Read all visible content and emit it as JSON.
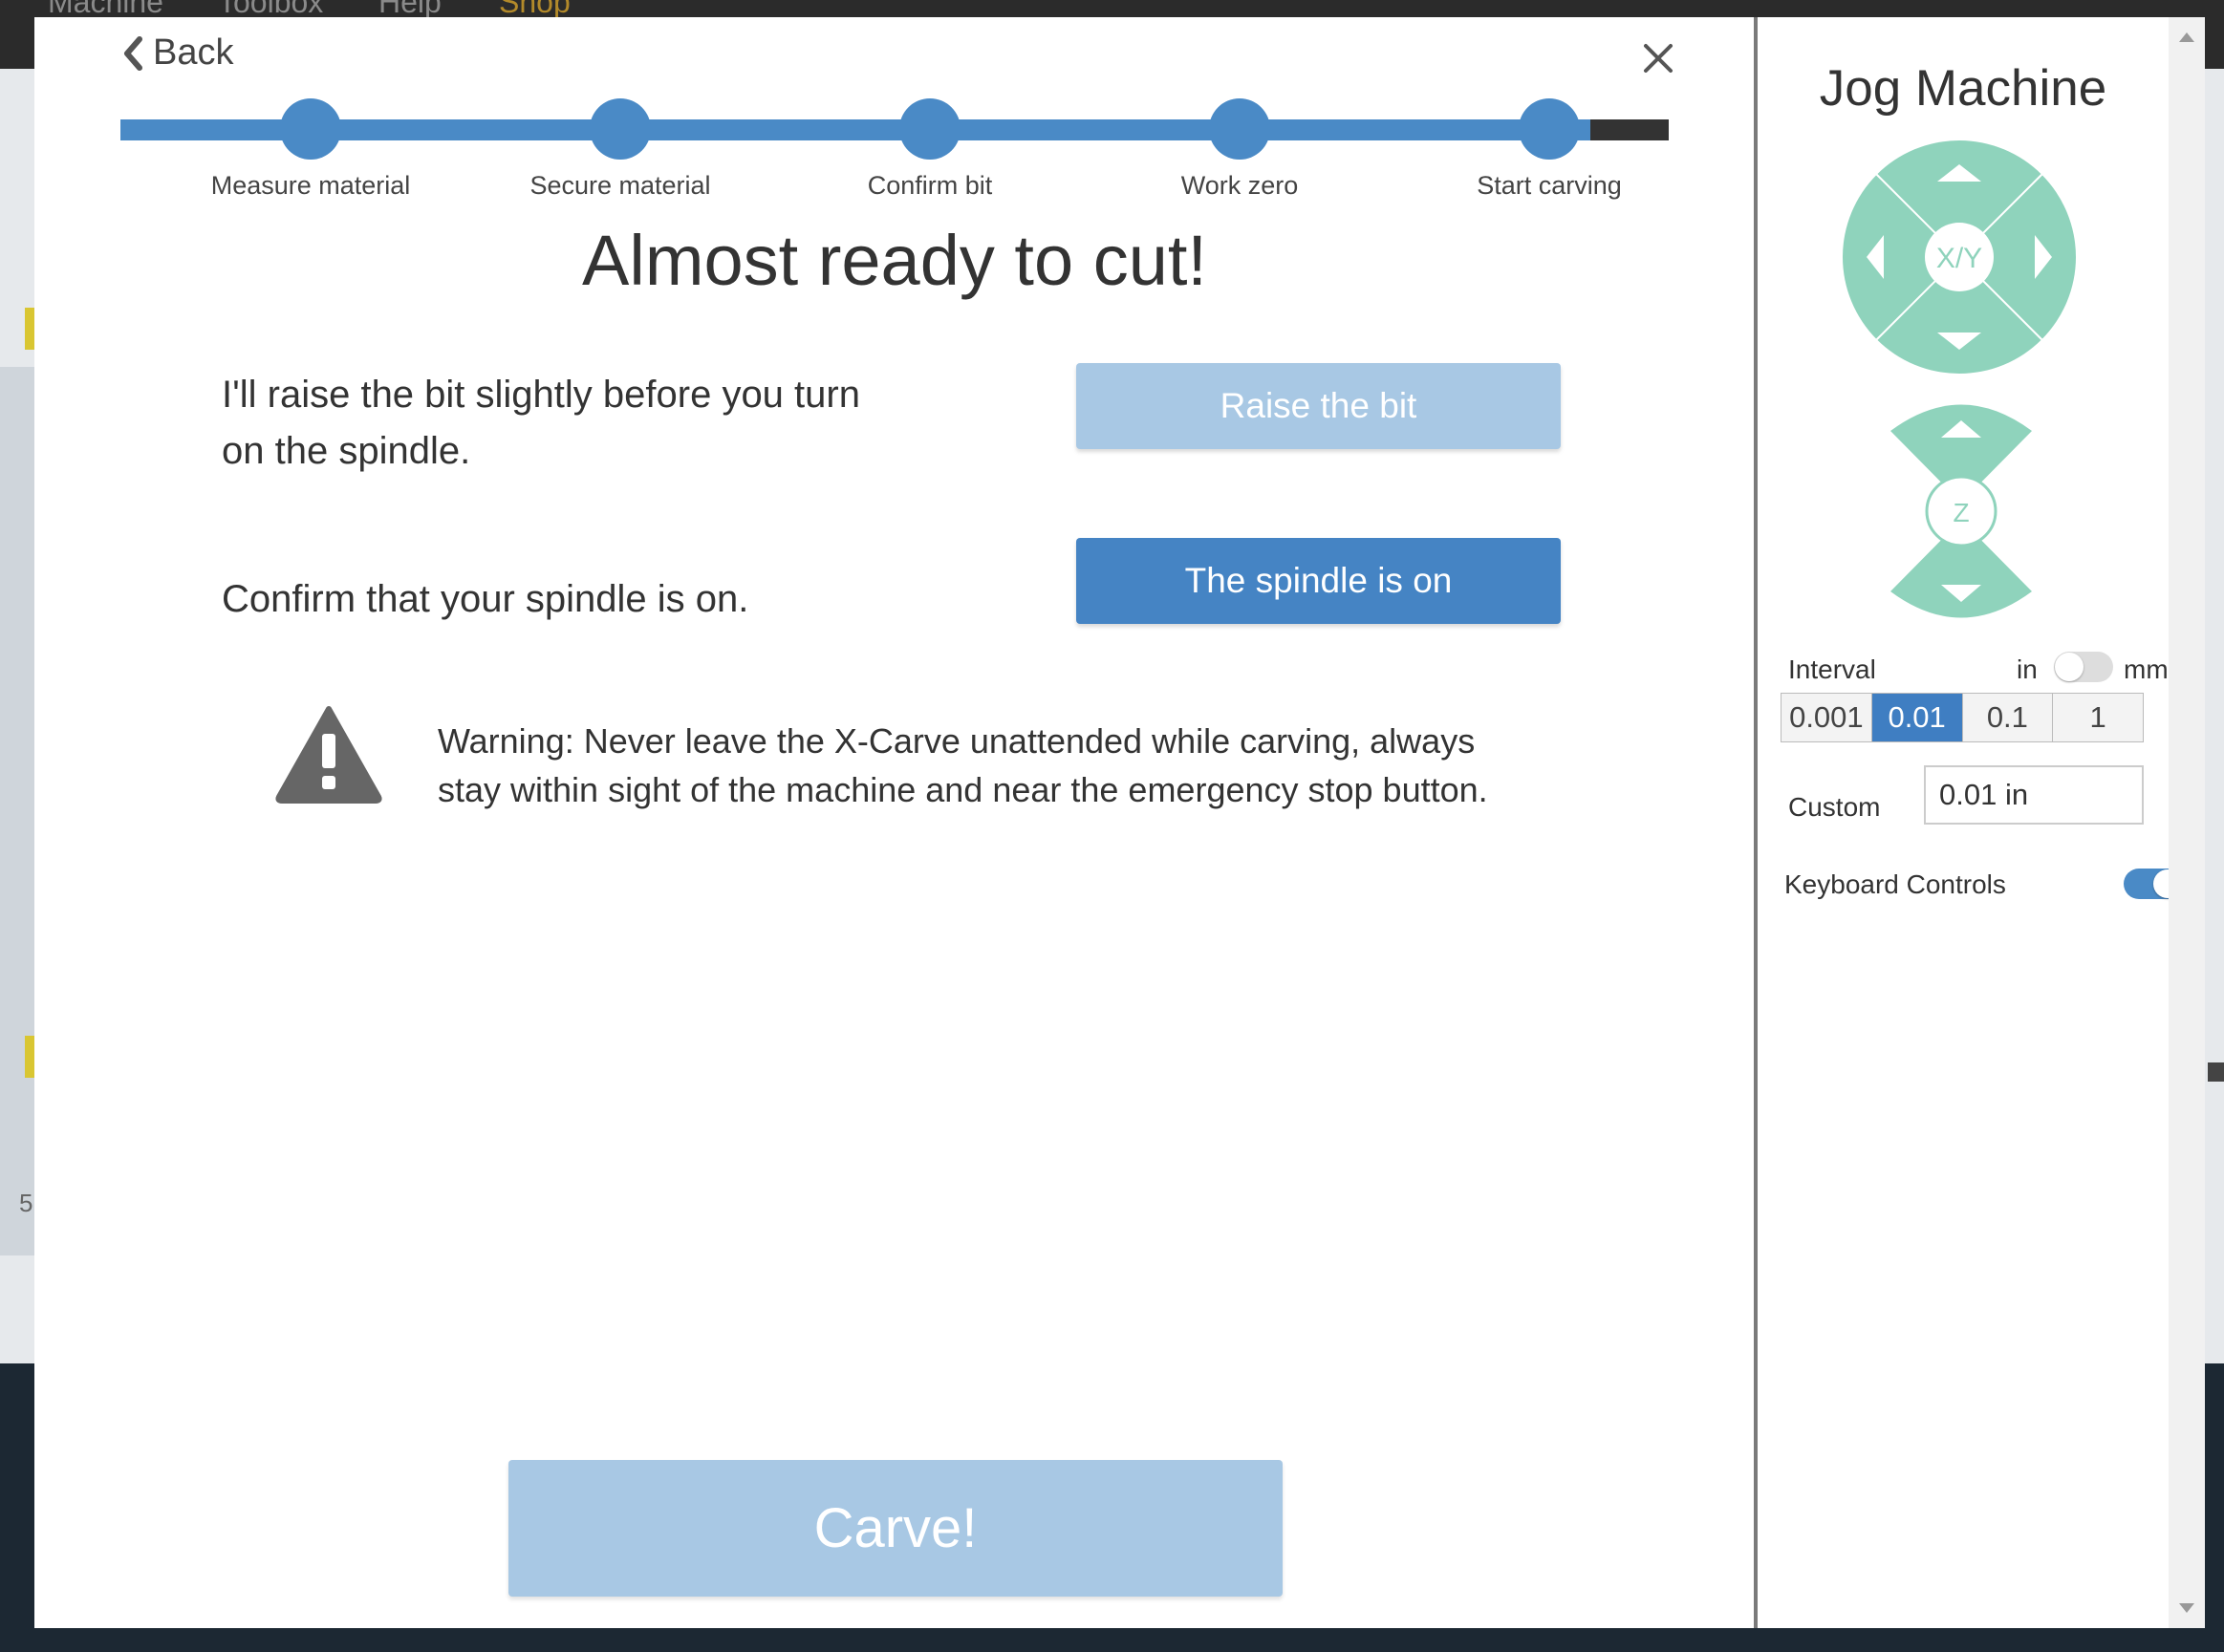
{
  "background_app": {
    "menu": [
      "Machine",
      "Toolbox",
      "Help",
      "Shop"
    ],
    "side_number": "5"
  },
  "modal": {
    "back_label": "Back",
    "steps": [
      {
        "label": "Measure material",
        "status": "complete"
      },
      {
        "label": "Secure material",
        "status": "complete"
      },
      {
        "label": "Confirm bit",
        "status": "complete"
      },
      {
        "label": "Work zero",
        "status": "complete"
      },
      {
        "label": "Start carving",
        "status": "current"
      }
    ],
    "heading": "Almost ready to cut!",
    "raise_row": {
      "text": "I'll raise the bit slightly before you turn on the spindle.",
      "button": "Raise the bit",
      "button_state": "disabled"
    },
    "spindle_row": {
      "text": "Confirm that your spindle is on.",
      "button": "The spindle is on",
      "button_state": "enabled"
    },
    "warning": "Warning: Never leave the X-Carve unattended while carving, always stay within sight of the machine and near the emergency stop button.",
    "carve_button": "Carve!",
    "carve_state": "disabled"
  },
  "jog": {
    "title": "Jog Machine",
    "xy_label": "X/Y",
    "z_label": "Z",
    "interval_label": "Interval",
    "unit_in": "in",
    "unit_mm": "mm",
    "unit_toggle": "in",
    "intervals": [
      "0.001",
      "0.01",
      "0.1",
      "1"
    ],
    "selected_interval": "0.01",
    "custom_label": "Custom",
    "custom_value": "0.01 in",
    "keyboard_label": "Keyboard Controls",
    "keyboard_enabled": true
  },
  "colors": {
    "accent": "#4a8ac6",
    "button_active": "#4584c4",
    "button_disabled": "#a8c8e4",
    "jog_pad": "#8fd3bc",
    "warning_icon": "#666666"
  }
}
